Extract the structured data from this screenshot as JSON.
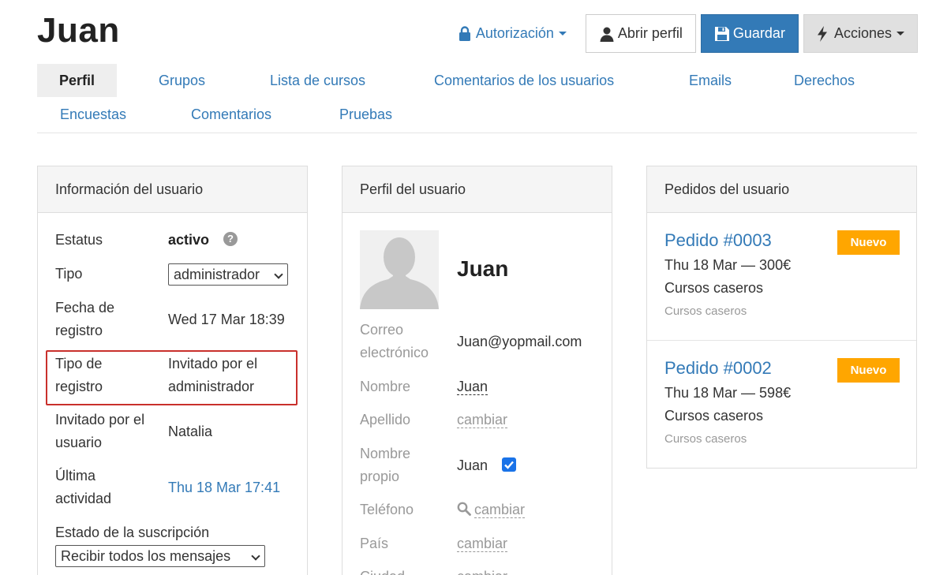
{
  "header": {
    "title": "Juan",
    "auth_label": "Autorización",
    "open_profile_label": "Abrir perfil",
    "save_label": "Guardar",
    "actions_label": "Acciones"
  },
  "tabs": [
    {
      "label": "Perfil",
      "active": true
    },
    {
      "label": "Grupos"
    },
    {
      "label": "Lista de cursos"
    },
    {
      "label": "Comentarios de los usuarios"
    },
    {
      "label": "Emails"
    },
    {
      "label": "Derechos"
    },
    {
      "label": "Encuestas"
    },
    {
      "label": "Comentarios"
    },
    {
      "label": "Pruebas"
    }
  ],
  "user_info": {
    "heading": "Información del usuario",
    "status_label": "Estatus",
    "status_value": "activo",
    "type_label": "Tipo",
    "type_value": "administrador",
    "reg_date_label_1": "Fecha de",
    "reg_date_label_2": "registro",
    "reg_date_value": "Wed 17 Mar 18:39",
    "reg_type_label_1": "Tipo de",
    "reg_type_label_2": "registro",
    "reg_type_value_1": "Invitado por el",
    "reg_type_value_2": "administrador",
    "invited_label_1": "Invitado por el",
    "invited_label_2": "usuario",
    "invited_value": "Natalia",
    "last_activity_label_1": "Última",
    "last_activity_label_2": "actividad",
    "last_activity_value": "Thu 18 Mar 17:41",
    "subscription_label": "Estado de la suscripción",
    "subscription_value": "Recibir todos los mensajes"
  },
  "user_profile": {
    "heading": "Perfil del usuario",
    "name": "Juan",
    "email_label_1": "Correo",
    "email_label_2": "electrónico",
    "email_value": "Juan@yopmail.com",
    "first_name_label": "Nombre",
    "first_name_value": "Juan",
    "last_name_label": "Apellido",
    "last_name_value": "cambiar",
    "own_name_label_1": "Nombre",
    "own_name_label_2": "propio",
    "own_name_value": "Juan",
    "phone_label": "Teléfono",
    "phone_value": "cambiar",
    "country_label": "País",
    "country_value": "cambiar",
    "city_label": "Ciudad",
    "city_value": "cambiar"
  },
  "orders": {
    "heading": "Pedidos del usuario",
    "items": [
      {
        "title": "Pedido #0003",
        "badge": "Nuevo",
        "date_price": "Thu 18 Mar — 300€",
        "product": "Cursos caseros",
        "sub": "Cursos caseros"
      },
      {
        "title": "Pedido #0002",
        "badge": "Nuevo",
        "date_price": "Thu 18 Mar — 598€",
        "product": "Cursos caseros",
        "sub": "Cursos caseros"
      }
    ]
  },
  "colors": {
    "link": "#337ab7",
    "primary": "#337ab7",
    "badge": "#ffa600",
    "highlight": "#c9302c"
  },
  "icons": {
    "auth": "lock-icon",
    "open_profile": "user-icon",
    "save": "floppy-disk-icon",
    "actions": "bolt-icon",
    "help": "question-circle-icon",
    "phone_search": "search-icon",
    "avatar": "default-avatar-icon"
  }
}
